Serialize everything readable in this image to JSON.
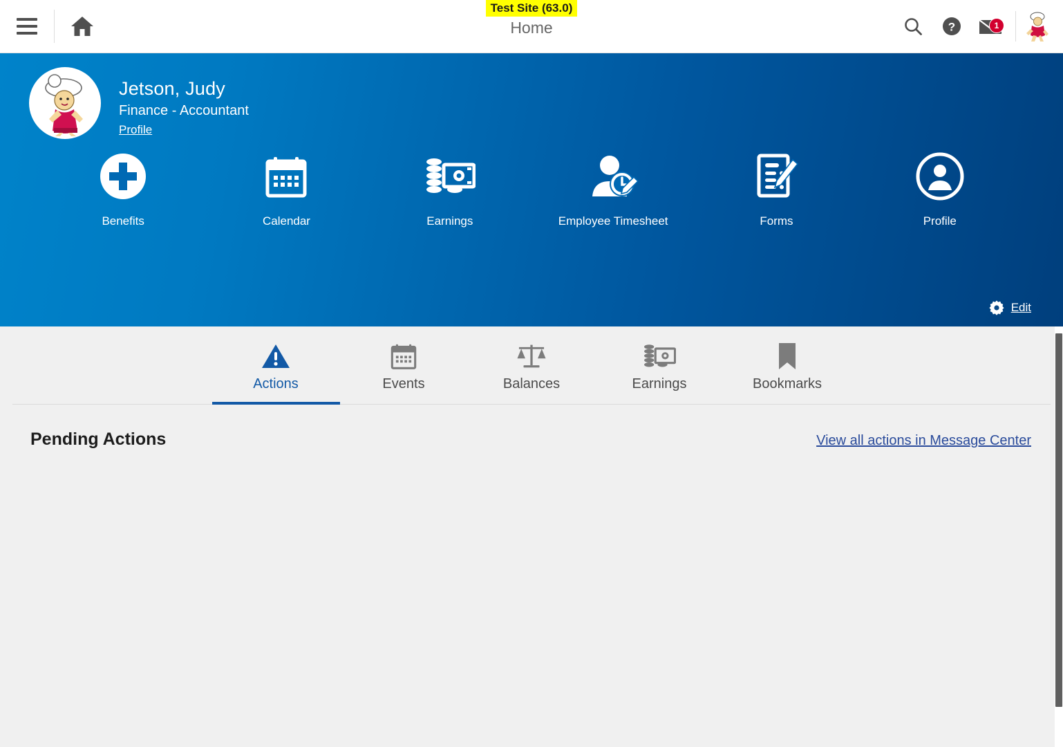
{
  "topbar": {
    "menu_icon": "hamburger-menu-icon",
    "home_icon": "home-icon",
    "test_badge": "Test Site (63.0)",
    "page_title": "Home",
    "search_icon": "search-icon",
    "help_icon": "help-circle-icon",
    "mail_icon": "envelope-icon",
    "mail_count": "1",
    "avatar_icon": "user-avatar-icon"
  },
  "hero": {
    "user_name": "Jetson, Judy",
    "user_role": "Finance - Accountant",
    "profile_link": "Profile",
    "edit_label": "Edit",
    "edit_icon": "gear-icon",
    "quicklinks": [
      {
        "label": "Benefits",
        "icon": "medical-plus-circle-icon"
      },
      {
        "label": "Calendar",
        "icon": "calendar-icon"
      },
      {
        "label": "Earnings",
        "icon": "money-coins-bill-icon"
      },
      {
        "label": "Employee Timesheet",
        "icon": "person-clock-pencil-icon"
      },
      {
        "label": "Forms",
        "icon": "document-pencil-icon"
      },
      {
        "label": "Profile",
        "icon": "person-circle-icon"
      }
    ]
  },
  "tabs": [
    {
      "label": "Actions",
      "icon": "warning-triangle-icon",
      "active": true
    },
    {
      "label": "Events",
      "icon": "calendar-icon",
      "active": false
    },
    {
      "label": "Balances",
      "icon": "scales-balance-icon",
      "active": false
    },
    {
      "label": "Earnings",
      "icon": "money-coins-bill-icon",
      "active": false
    },
    {
      "label": "Bookmarks",
      "icon": "bookmark-icon",
      "active": false
    }
  ],
  "main": {
    "section_title": "Pending Actions",
    "section_link": "View all actions in Message Center"
  },
  "colors": {
    "brand_blue": "#0079c1",
    "brand_blue_dark": "#003f7d",
    "accent_link": "#2a4b9b",
    "active_tab": "#1259a6",
    "badge_red": "#d2002f",
    "badge_yellow": "#ffff00",
    "content_bg": "#f0f0f0"
  }
}
